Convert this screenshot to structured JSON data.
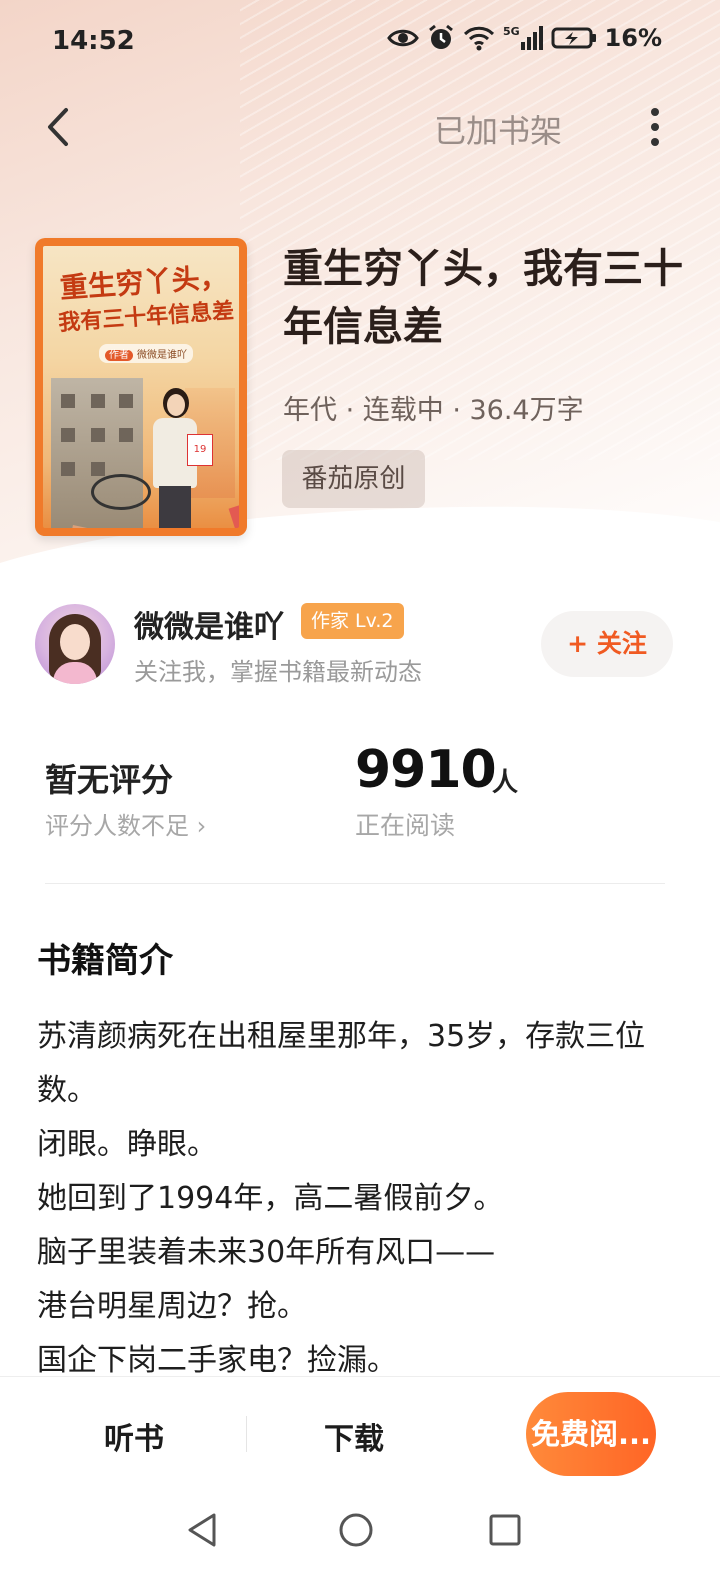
{
  "status_bar": {
    "time": "14:52",
    "network": "5G",
    "battery": "16%"
  },
  "nav": {
    "shelf_label": "已加书架"
  },
  "book": {
    "cover": {
      "title_line1": "重生穷丫头，",
      "title_line2": "我有三十年信息差",
      "author_tag": "作者",
      "author_name": "微微是谁吖",
      "calendar_day": "19"
    },
    "title": "重生穷丫头，我有三十年信息差",
    "meta": "年代 · 连载中 · 36.4万字",
    "tag": "番茄原创"
  },
  "author": {
    "name": "微微是谁吖",
    "badge": "作家 Lv.2",
    "subtitle": "关注我，掌握书籍最新动态",
    "follow_label": "+ 关注"
  },
  "stats": {
    "rating_label": "暂无评分",
    "rating_sub": "评分人数不足 ›",
    "readers_count": "9910",
    "readers_unit": "人",
    "readers_sub": "正在阅读"
  },
  "synopsis": {
    "title": "书籍简介",
    "lines": [
      "苏清颜病死在出租屋里那年，35岁，存款三位数。",
      "闭眼。睁眼。",
      "她回到了1994年，高二暑假前夕。",
      "脑子里装着未来30年所有风口——",
      "港台明星周边？抢。",
      "国企下岗二手家电？捡漏。"
    ]
  },
  "bottom_bar": {
    "listen_label": "听书",
    "download_label": "下载",
    "read_label": "免费阅..."
  },
  "colors": {
    "accent": "#ff6a28",
    "badge": "#f7a44c",
    "follow_text": "#f05a22"
  }
}
